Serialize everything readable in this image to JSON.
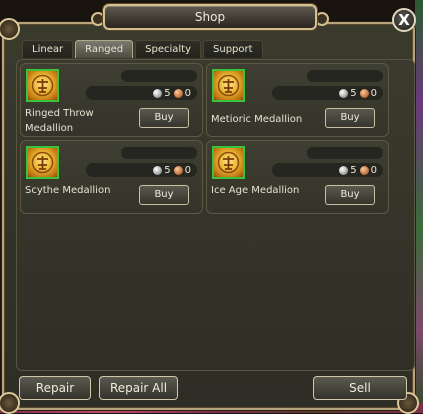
{
  "window": {
    "title": "Shop",
    "close_label": "X"
  },
  "tabs": [
    {
      "label": "Linear",
      "active": false
    },
    {
      "label": "Ranged",
      "active": true
    },
    {
      "label": "Specialty",
      "active": false
    },
    {
      "label": "Support",
      "active": false
    }
  ],
  "items": [
    {
      "name": "Ringed Throw Medallion",
      "silver": "5",
      "copper": "0",
      "buy_label": "Buy",
      "icon": "medallion-icon"
    },
    {
      "name": "Metioric Medallion",
      "silver": "5",
      "copper": "0",
      "buy_label": "Buy",
      "icon": "medallion-icon"
    },
    {
      "name": "Scythe Medallion",
      "silver": "5",
      "copper": "0",
      "buy_label": "Buy",
      "icon": "medallion-icon"
    },
    {
      "name": "Ice Age Medallion",
      "silver": "5",
      "copper": "0",
      "buy_label": "Buy",
      "icon": "medallion-icon"
    }
  ],
  "footer": {
    "repair_label": "Repair",
    "repair_all_label": "Repair All",
    "sell_label": "Sell"
  },
  "colors": {
    "frame_gold": "#d4c08e",
    "icon_border": "#3ac43a",
    "panel_bg": "#3a3a2e"
  }
}
